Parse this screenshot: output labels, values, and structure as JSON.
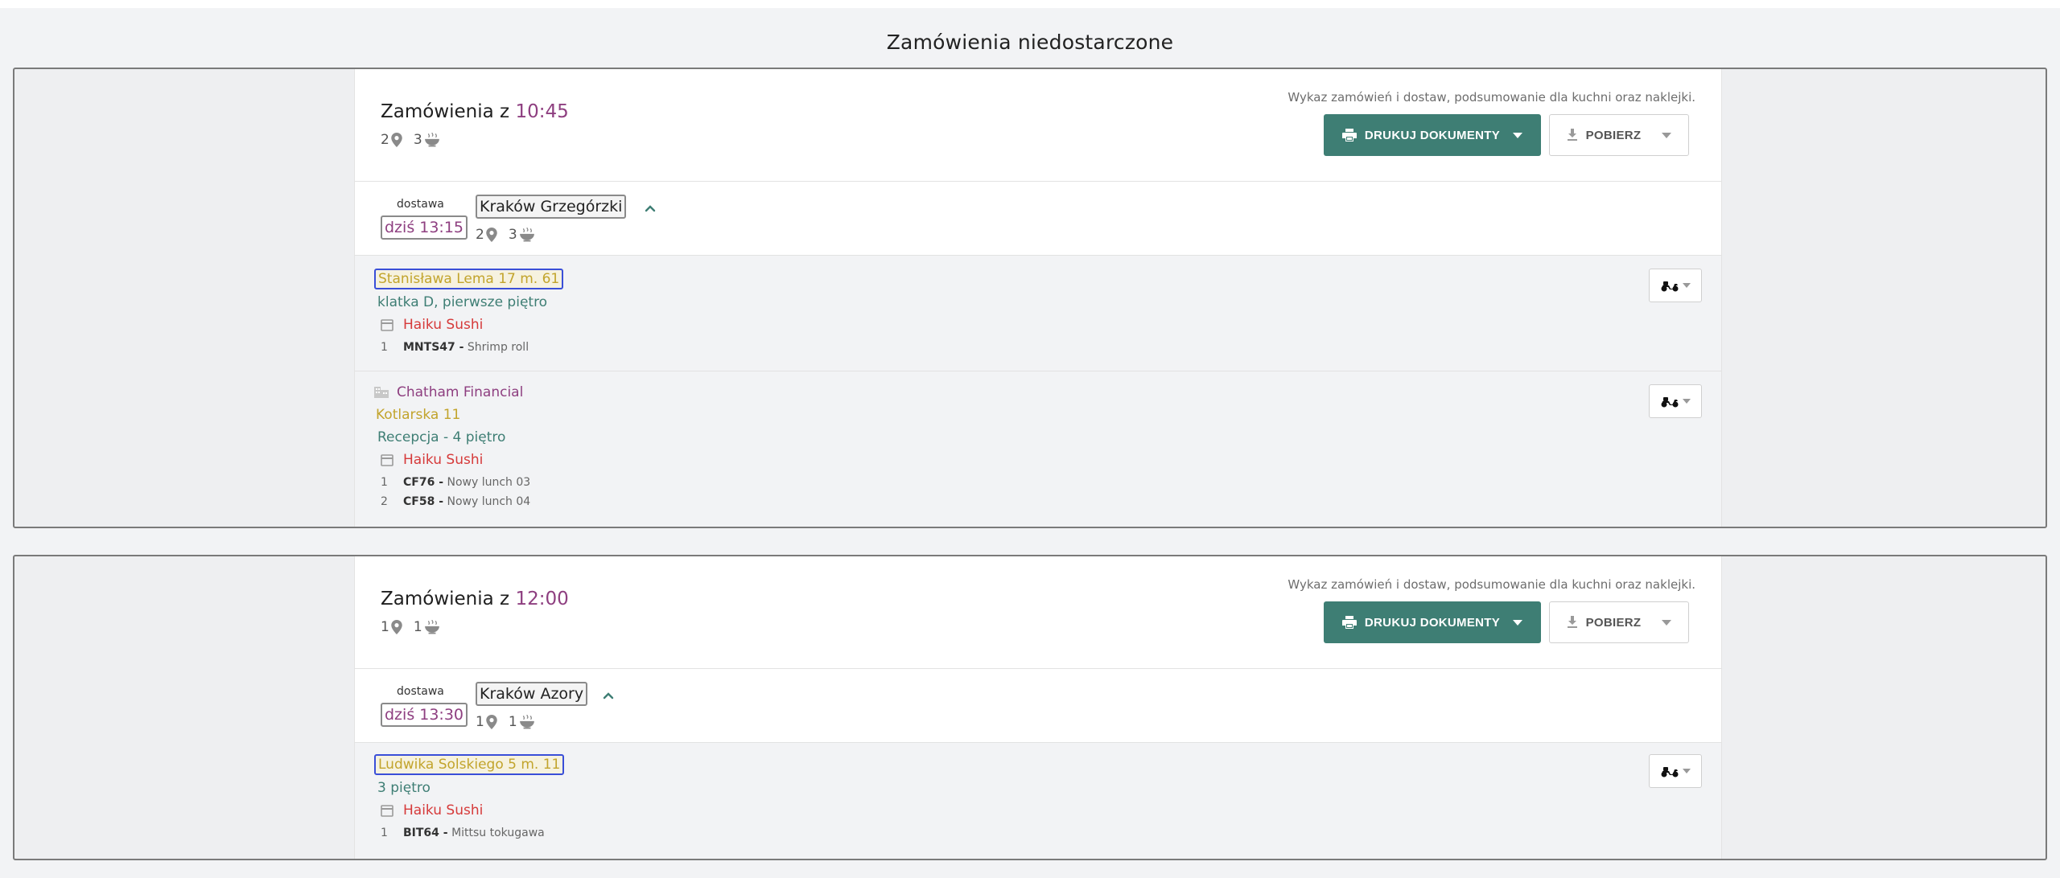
{
  "page": {
    "title": "Zamówienia niedostarczone"
  },
  "colors": {
    "accent": "#8e3f80",
    "primary_button": "#3e7e74",
    "address": "#c2a42c",
    "restaurant": "#d63a3a",
    "note": "#3e7e74"
  },
  "icons": {
    "location": "map-pin-icon",
    "meals": "food-bowl-icon",
    "print": "printer-icon",
    "download": "download-icon",
    "courier": "scooter-icon",
    "restaurant": "store-icon",
    "company": "building-icon",
    "collapse": "chevron-up-icon"
  },
  "batches": [
    {
      "title_prefix": "Zamówienia z",
      "time": "10:45",
      "locations": "2",
      "meals": "3",
      "description": "Wykaz zamówień i dostaw, podsumowanie dla kuchni oraz naklejki.",
      "print_label": "DRUKUJ DOKUMENTY",
      "download_label": "POBIERZ",
      "route": {
        "delivery_label": "dostawa",
        "delivery_time": "dziś 13:15",
        "name": "Kraków Grzegórzki",
        "locations": "2",
        "meals": "3"
      },
      "orders": [
        {
          "address": "Stanisława Lema 17 m. 61",
          "note": "klatka D, pierwsze piętro",
          "restaurant": "Haiku Sushi",
          "items": [
            {
              "qty": "1",
              "code": "MNTS47 -",
              "name": "Shrimp roll"
            }
          ]
        },
        {
          "company": "Chatham Financial",
          "address": "Kotlarska 11",
          "note": "Recepcja - 4 piętro",
          "restaurant": "Haiku Sushi",
          "items": [
            {
              "qty": "1",
              "code": "CF76 -",
              "name": "Nowy lunch 03"
            },
            {
              "qty": "2",
              "code": "CF58 -",
              "name": "Nowy lunch 04"
            }
          ]
        }
      ]
    },
    {
      "title_prefix": "Zamówienia z",
      "time": "12:00",
      "locations": "1",
      "meals": "1",
      "description": "Wykaz zamówień i dostaw, podsumowanie dla kuchni oraz naklejki.",
      "print_label": "DRUKUJ DOKUMENTY",
      "download_label": "POBIERZ",
      "route": {
        "delivery_label": "dostawa",
        "delivery_time": "dziś 13:30",
        "name": "Kraków Azory",
        "locations": "1",
        "meals": "1"
      },
      "orders": [
        {
          "address": "Ludwika Solskiego 5 m. 11",
          "note": "3 piętro",
          "restaurant": "Haiku Sushi",
          "items": [
            {
              "qty": "1",
              "code": "BIT64 -",
              "name": "Mittsu tokugawa"
            }
          ]
        }
      ]
    }
  ]
}
